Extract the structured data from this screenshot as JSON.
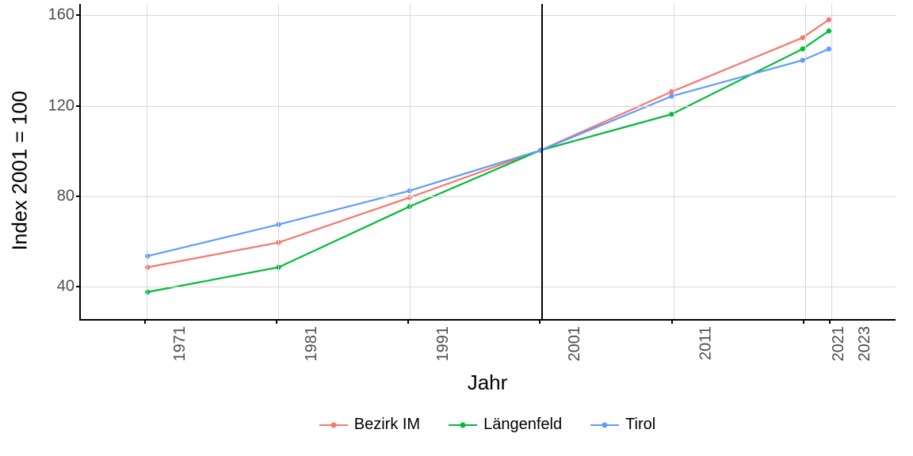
{
  "chart_data": {
    "type": "line",
    "xlabel": "Jahr",
    "ylabel": "Index 2001 = 100",
    "ylim": [
      25,
      165
    ],
    "xlim": [
      1966,
      2028
    ],
    "y_ticks": [
      40,
      80,
      120,
      160
    ],
    "x_ticks": [
      1971,
      1981,
      1991,
      2001,
      2011,
      2021,
      2023
    ],
    "x": [
      1971,
      1981,
      1991,
      2001,
      2011,
      2021,
      2023
    ],
    "ref_x": 2001,
    "series": [
      {
        "name": "Bezirk IM",
        "color": "#f8766d",
        "values": [
          48,
          59,
          79,
          100,
          126,
          150,
          158
        ]
      },
      {
        "name": "Längenfeld",
        "color": "#00ba38",
        "values": [
          37,
          48,
          75,
          100,
          116,
          145,
          153
        ]
      },
      {
        "name": "Tirol",
        "color": "#619cff",
        "values": [
          53,
          67,
          82,
          100,
          124,
          140,
          145
        ]
      }
    ],
    "legend_position": "bottom",
    "grid": true
  }
}
